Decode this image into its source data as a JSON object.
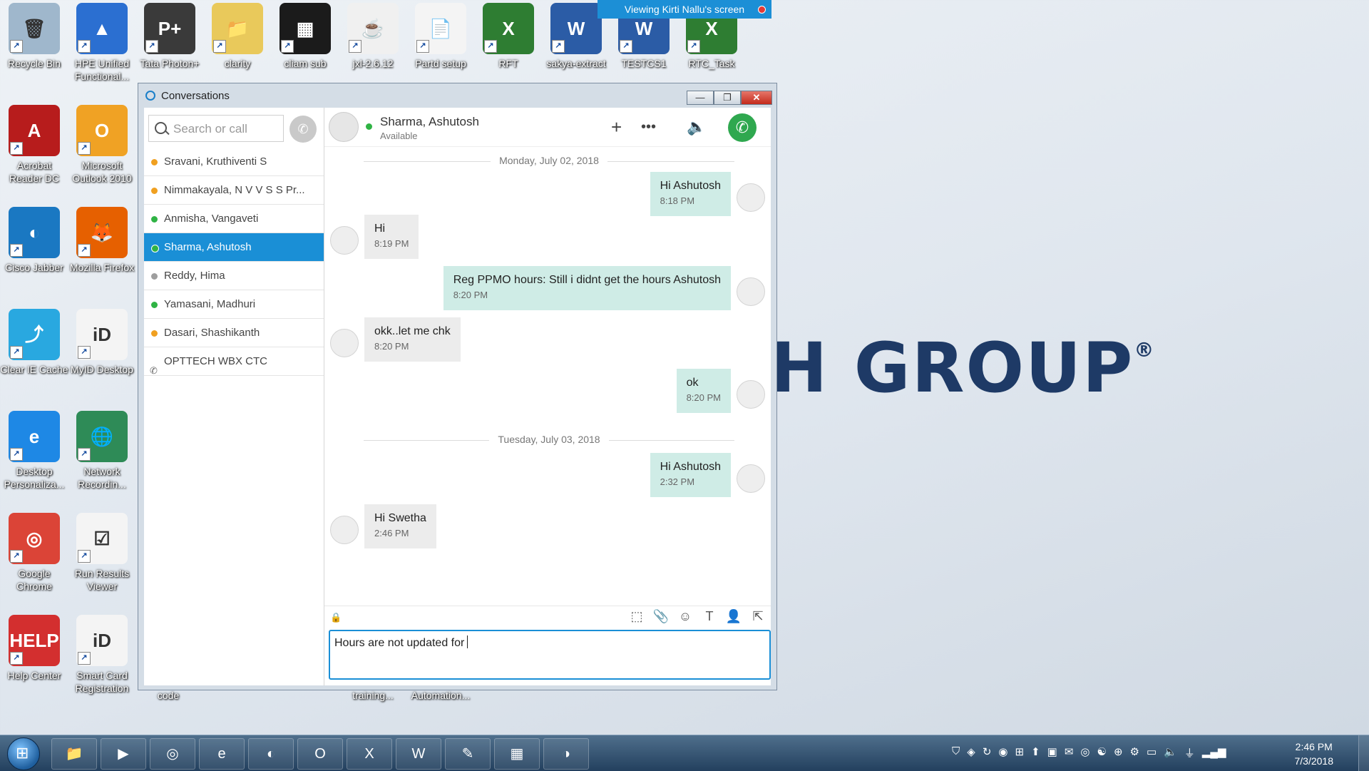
{
  "banner": {
    "text": "Viewing Kirti Nallu's screen"
  },
  "brand_text": "H GROUP",
  "brand_mark": "®",
  "desktop_icons": [
    {
      "label": "Recycle Bin",
      "icon": "recycle-bin-icon",
      "color": "#9fb7cc"
    },
    {
      "label": "HPE Unified Functional...",
      "icon": "hpe-uft-icon",
      "color": "#2b6fd1"
    },
    {
      "label": "Tata Photon+",
      "icon": "photon-icon",
      "color": "#3a3a3a"
    },
    {
      "label": "clarity",
      "icon": "folder-icon",
      "color": "#e9c95b"
    },
    {
      "label": "cliam sub",
      "icon": "screenshot-icon",
      "color": "#1b1b1b"
    },
    {
      "label": "jxl-2.6.12",
      "icon": "java-icon",
      "color": "#f0f0f0"
    },
    {
      "label": "Partd setup",
      "icon": "document-icon",
      "color": "#f4f4f4"
    },
    {
      "label": "RFT",
      "icon": "excel-icon",
      "color": "#2e7d32"
    },
    {
      "label": "sakya-extract",
      "icon": "word-icon",
      "color": "#2b5ca6"
    },
    {
      "label": "TESTCS1",
      "icon": "word-icon",
      "color": "#2b5ca6"
    },
    {
      "label": "RTC_Task",
      "icon": "excel-icon",
      "color": "#2e7d32"
    },
    {
      "label": "Acrobat Reader DC",
      "icon": "acrobat-icon",
      "color": "#b71c1c"
    },
    {
      "label": "Microsoft Outlook 2010",
      "icon": "outlook-icon",
      "color": "#f0a224"
    },
    {
      "label": "Cisco Jabber",
      "icon": "jabber-icon",
      "color": "#1a78c2"
    },
    {
      "label": "Mozilla Firefox",
      "icon": "firefox-icon",
      "color": "#e66000"
    },
    {
      "label": "Clear IE Cache",
      "icon": "clear-cache-icon",
      "color": "#29a8e0"
    },
    {
      "label": "MyID Desktop",
      "icon": "myid-icon",
      "color": "#f4f4f4"
    },
    {
      "label": "Desktop Personaliza...",
      "icon": "ie-icon",
      "color": "#1e88e5"
    },
    {
      "label": "Network Recordin...",
      "icon": "globe-icon",
      "color": "#2e8b57"
    },
    {
      "label": "Google Chrome",
      "icon": "chrome-icon",
      "color": "#db4437"
    },
    {
      "label": "Run Results Viewer",
      "icon": "checklist-icon",
      "color": "#f4f4f4"
    },
    {
      "label": "Help Center",
      "icon": "help-icon",
      "color": "#d32f2f"
    },
    {
      "label": "Smart Card Registration",
      "icon": "myid-icon",
      "color": "#f4f4f4"
    }
  ],
  "hidden_labels": [
    "code",
    "training...",
    "Automation..."
  ],
  "window": {
    "title": "Conversations",
    "controls": {
      "minimize": "—",
      "maximize": "❐",
      "close": "✕"
    }
  },
  "search": {
    "placeholder": "Search or call"
  },
  "contacts": [
    {
      "name": "Sravani, Kruthiventi S",
      "status_color": "#f0a020"
    },
    {
      "name": "Nimmakayala, N V V S S Pr...",
      "status_color": "#f0a020"
    },
    {
      "name": "Anmisha, Vangaveti",
      "status_color": "#2fb344"
    },
    {
      "name": "Sharma, Ashutosh",
      "status_color": "#2fb344",
      "selected": true
    },
    {
      "name": "Reddy, Hima",
      "status_color": "#9e9e9e"
    },
    {
      "name": "Yamasani, Madhuri",
      "status_color": "#2fb344"
    },
    {
      "name": "Dasari, Shashikanth",
      "status_color": "#f0a020"
    },
    {
      "name": "OPTTECH WBX CTC",
      "status_color": "phone"
    }
  ],
  "conversation": {
    "name": "Sharma, Ashutosh",
    "status": "Available",
    "status_color": "#2fb344",
    "add_label": "+",
    "more_label": "•••",
    "call_color": "#2fa84f"
  },
  "day_separators": [
    "Monday, July 02, 2018",
    "Tuesday, July 03, 2018"
  ],
  "messages": [
    {
      "dir": "out",
      "text": "Hi Ashutosh",
      "time": "8:18 PM"
    },
    {
      "dir": "in",
      "text": "Hi",
      "time": "8:19 PM"
    },
    {
      "dir": "out",
      "text": "Reg PPMO hours: Still i didnt get the hours Ashutosh",
      "time": "8:20 PM"
    },
    {
      "dir": "in",
      "text": "okk..let me chk",
      "time": "8:20 PM"
    },
    {
      "dir": "out",
      "text": "ok",
      "time": "8:20 PM"
    },
    {
      "dir": "out",
      "text": "Hi Ashutosh",
      "time": "2:32 PM"
    },
    {
      "dir": "in",
      "text": "Hi Swetha",
      "time": "2:46 PM"
    }
  ],
  "compose": {
    "value": "Hours are not updated for"
  },
  "taskbar_apps": [
    "explorer",
    "media-player",
    "chrome",
    "ie",
    "jabber",
    "outlook",
    "excel",
    "word",
    "notepad",
    "photos",
    "webex"
  ],
  "clock": {
    "time": "2:46 PM",
    "date": "7/3/2018"
  }
}
